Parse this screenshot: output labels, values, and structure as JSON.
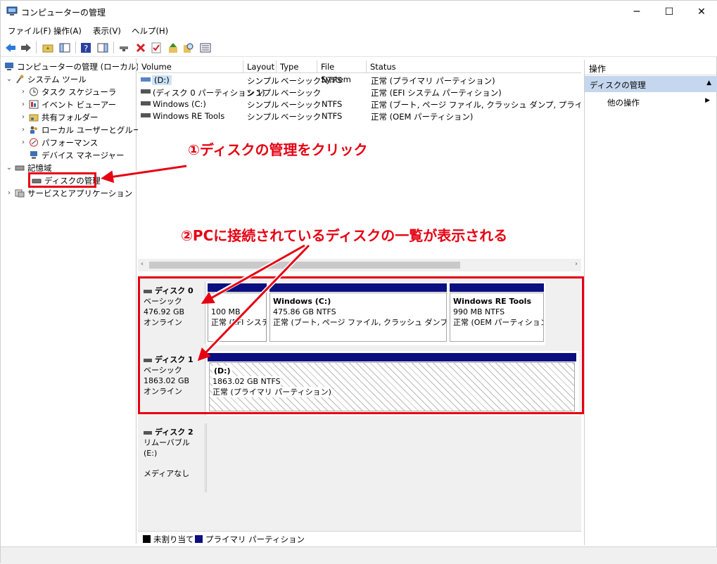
{
  "window": {
    "title": "コンピューターの管理",
    "minimize": "─",
    "maximize": "☐",
    "close": "✕"
  },
  "menu": [
    {
      "label": "ファイル(F)"
    },
    {
      "label": "操作(A)"
    },
    {
      "label": "表示(V)"
    },
    {
      "label": "ヘルプ(H)"
    }
  ],
  "tree": {
    "root": "コンピューターの管理 (ローカル)",
    "system_tools": "システム ツール",
    "task_scheduler": "タスク スケジューラ",
    "event_viewer": "イベント ビューアー",
    "shared_folders": "共有フォルダー",
    "local_users": "ローカル ユーザーとグループ",
    "performance": "パフォーマンス",
    "device_manager": "デバイス マネージャー",
    "storage": "記憶域",
    "disk_management": "ディスクの管理",
    "services_apps": "サービスとアプリケーション"
  },
  "volumes": {
    "headers": [
      "Volume",
      "Layout",
      "Type",
      "File System",
      "Status"
    ],
    "rows": [
      [
        "(D:)",
        "シンプル",
        "ベーシック",
        "NTFS",
        "正常 (プライマリ パーティション)"
      ],
      [
        "(ディスク 0 パーティション 1)",
        "シンプル",
        "ベーシック",
        "",
        "正常 (EFI システム パーティション)"
      ],
      [
        "Windows (C:)",
        "シンプル",
        "ベーシック",
        "NTFS",
        "正常 (ブート, ページ ファイル, クラッシュ ダンプ, プライマリ パーティシ"
      ],
      [
        "Windows RE Tools",
        "シンプル",
        "ベーシック",
        "NTFS",
        "正常 (OEM パーティション)"
      ]
    ]
  },
  "disks": {
    "disk0": {
      "name": "ディスク 0",
      "type": "ベーシック",
      "size": "476.92 GB",
      "state": "オンライン",
      "p1": {
        "size": "100 MB",
        "status": "正常 (EFI システ"
      },
      "p2": {
        "name": "Windows (C:)",
        "size": "475.86 GB NTFS",
        "status": "正常 (ブート, ページ ファイル, クラッシュ ダンプ, プライ"
      },
      "p3": {
        "name": "Windows RE Tools",
        "size": "990 MB NTFS",
        "status": "正常 (OEM パーティション"
      }
    },
    "disk1": {
      "name": "ディスク 1",
      "type": "ベーシック",
      "size": "1863.02 GB",
      "state": "オンライン",
      "p1": {
        "name": "(D:)",
        "size": "1863.02 GB NTFS",
        "status": "正常 (プライマリ パーティション)"
      }
    },
    "disk2": {
      "name": "ディスク 2",
      "type": "リムーバブル (E:)",
      "state": "メディアなし"
    }
  },
  "legend": {
    "unallocated": "未割り当て",
    "primary": "プライマリ パーティション",
    "unallocated_color": "#000000",
    "primary_color": "#0b0f80"
  },
  "actions": {
    "header": "操作",
    "section": "ディスクの管理",
    "other": "他の操作"
  },
  "annotations": {
    "step1": "①ディスクの管理をクリック",
    "step2": "②PCに接続されているディスクの一覧が表示される",
    "color": "#e60012"
  }
}
